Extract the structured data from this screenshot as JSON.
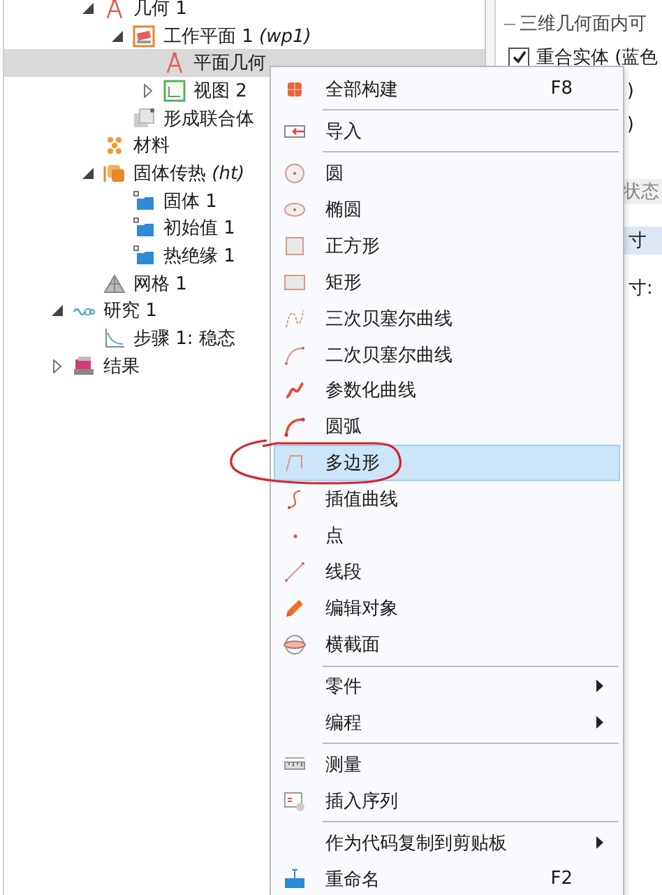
{
  "tree": {
    "items": [
      {
        "children": [
          {
            "label": "几何 1",
            "kind": "geometry",
            "expanded": true,
            "selected": false,
            "children": [
              {
                "label": "工作平面 1 *(wp1)*",
                "kind": "workplane",
                "expanded": true,
                "selected": false,
                "children": [
                  {
                    "label": "平面几何",
                    "kind": "sketch",
                    "selected": true
                  },
                  {
                    "label": "视图 2",
                    "kind": "view",
                    "expanded": false,
                    "selected": false
                  }
                ]
              },
              {
                "label": "形成联合体",
                "kind": "union",
                "selected": false
              }
            ]
          },
          {
            "label": "材料",
            "kind": "material",
            "selected": false
          },
          {
            "label": "固体传热 *(ht)*",
            "kind": "physics",
            "expanded": true,
            "selected": false,
            "children": [
              {
                "label": "固体 1",
                "kind": "domain",
                "selected": false
              },
              {
                "label": "初始值 1",
                "kind": "domain",
                "selected": false
              },
              {
                "label": "热绝缘 1",
                "kind": "domain",
                "selected": false
              }
            ]
          },
          {
            "label": "网格 1",
            "kind": "mesh",
            "selected": false
          }
        ]
      },
      {
        "label": "研究 1",
        "kind": "study",
        "expanded": true,
        "selected": false,
        "children": [
          {
            "label": "步骤 1: 稳态",
            "kind": "step",
            "selected": false
          }
        ]
      },
      {
        "label": "结果",
        "kind": "results",
        "expanded": false,
        "selected": false
      }
    ]
  },
  "settings": {
    "group_title": "三维几何面内可",
    "checkbox": {
      "label": "重合实体 (蓝色",
      "checked": true
    },
    "fragments": [
      {
        "text": ")",
        "kind": "text"
      },
      {
        "text": ")",
        "kind": "text"
      },
      {
        "text": "状态",
        "kind": "section"
      },
      {
        "text": "寸",
        "kind": "highlight"
      },
      {
        "text": "寸:",
        "kind": "text"
      }
    ]
  },
  "context_menu": {
    "items": [
      {
        "kind": "build",
        "label": "全部构建",
        "shortcut": "F8",
        "selected": false
      },
      {
        "kind": "separator"
      },
      {
        "kind": "import",
        "label": "导入",
        "selected": false
      },
      {
        "kind": "separator"
      },
      {
        "kind": "circle",
        "label": "圆",
        "selected": false
      },
      {
        "kind": "ellipse",
        "label": "椭圆",
        "selected": false
      },
      {
        "kind": "square",
        "label": "正方形",
        "selected": false
      },
      {
        "kind": "rectangle",
        "label": "矩形",
        "selected": false
      },
      {
        "kind": "bezier3",
        "label": "三次贝塞尔曲线",
        "selected": false
      },
      {
        "kind": "bezier2",
        "label": "二次贝塞尔曲线",
        "selected": false
      },
      {
        "kind": "parametric",
        "label": "参数化曲线",
        "selected": false
      },
      {
        "kind": "arc",
        "label": "圆弧",
        "selected": false
      },
      {
        "kind": "polygon",
        "label": "多边形",
        "selected": true
      },
      {
        "kind": "interpolation",
        "label": "插值曲线",
        "selected": false
      },
      {
        "kind": "point",
        "label": "点",
        "selected": false
      },
      {
        "kind": "segment",
        "label": "线段",
        "selected": false
      },
      {
        "kind": "edit",
        "label": "编辑对象",
        "selected": false
      },
      {
        "kind": "crosssection",
        "label": "横截面",
        "selected": false
      },
      {
        "kind": "separator"
      },
      {
        "kind": "plain",
        "label": "零件",
        "submenu": true,
        "selected": false
      },
      {
        "kind": "plain",
        "label": "编程",
        "submenu": true,
        "selected": false
      },
      {
        "kind": "separator"
      },
      {
        "kind": "measure",
        "label": "测量",
        "selected": false
      },
      {
        "kind": "sequence",
        "label": "插入序列",
        "selected": false
      },
      {
        "kind": "separator"
      },
      {
        "kind": "plain",
        "label": "作为代码复制到剪贴板",
        "submenu": true,
        "selected": false
      },
      {
        "kind": "rename",
        "label": "重命名",
        "shortcut": "F2",
        "selected": false
      }
    ]
  }
}
